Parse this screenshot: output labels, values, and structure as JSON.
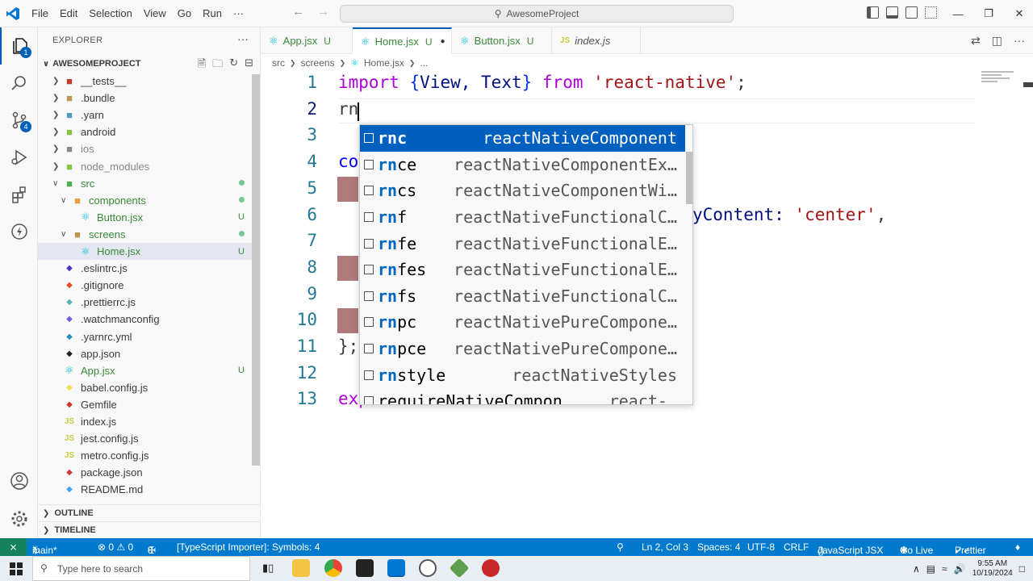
{
  "titlebar": {
    "menus": [
      "File",
      "Edit",
      "Selection",
      "View",
      "Go",
      "Run",
      "···"
    ],
    "search_placeholder": "AwesomeProject"
  },
  "activity": {
    "explorer_badge": "1",
    "scm_badge": "4"
  },
  "sidebar": {
    "title": "EXPLORER",
    "project": "AWESOMEPROJECT",
    "tree": [
      {
        "name": "__tests__",
        "kind": "folder",
        "expanded": false,
        "depth": 0,
        "color": "#c0392b",
        "status": ""
      },
      {
        "name": ".bundle",
        "kind": "folder",
        "expanded": false,
        "depth": 0,
        "color": "#c09553",
        "status": ""
      },
      {
        "name": ".yarn",
        "kind": "folder",
        "expanded": false,
        "depth": 0,
        "color": "#519aba",
        "status": ""
      },
      {
        "name": "android",
        "kind": "folder",
        "expanded": false,
        "depth": 0,
        "color": "#8bc34a",
        "status": ""
      },
      {
        "name": "ios",
        "kind": "folder",
        "expanded": false,
        "depth": 0,
        "color": "#888888",
        "status": ""
      },
      {
        "name": "node_modules",
        "kind": "folder",
        "expanded": false,
        "depth": 0,
        "color": "#8bc34a",
        "status": ""
      },
      {
        "name": "src",
        "kind": "folder",
        "expanded": true,
        "depth": 0,
        "color": "#4caf50",
        "status": "dot"
      },
      {
        "name": "components",
        "kind": "folder",
        "expanded": true,
        "depth": 1,
        "color": "#e6a23c",
        "status": "dot"
      },
      {
        "name": "Button.jsx",
        "kind": "react",
        "depth": 2,
        "color": "#00bcd4",
        "status": "U"
      },
      {
        "name": "screens",
        "kind": "folder",
        "expanded": true,
        "depth": 1,
        "color": "#c09553",
        "status": "dot"
      },
      {
        "name": "Home.jsx",
        "kind": "react",
        "depth": 2,
        "color": "#00bcd4",
        "status": "U",
        "selected": true
      },
      {
        "name": ".eslintrc.js",
        "kind": "file",
        "depth": 0,
        "color": "#4b32c3",
        "status": ""
      },
      {
        "name": ".gitignore",
        "kind": "file",
        "depth": 0,
        "color": "#e44d26",
        "status": ""
      },
      {
        "name": ".prettierrc.js",
        "kind": "file",
        "depth": 0,
        "color": "#56b3b4",
        "status": ""
      },
      {
        "name": ".watchmanconfig",
        "kind": "file",
        "depth": 0,
        "color": "#6b5fe0",
        "status": ""
      },
      {
        "name": ".yarnrc.yml",
        "kind": "file",
        "depth": 0,
        "color": "#2c8ebb",
        "status": ""
      },
      {
        "name": "app.json",
        "kind": "file",
        "depth": 0,
        "color": "#222222",
        "status": ""
      },
      {
        "name": "App.jsx",
        "kind": "react",
        "depth": 0,
        "color": "#00bcd4",
        "status": "U"
      },
      {
        "name": "babel.config.js",
        "kind": "file",
        "depth": 0,
        "color": "#f5da55",
        "status": ""
      },
      {
        "name": "Gemfile",
        "kind": "file",
        "depth": 0,
        "color": "#cc342d",
        "status": ""
      },
      {
        "name": "index.js",
        "kind": "js",
        "depth": 0,
        "color": "#cbcb41",
        "status": ""
      },
      {
        "name": "jest.config.js",
        "kind": "js",
        "depth": 0,
        "color": "#cbcb41",
        "status": ""
      },
      {
        "name": "metro.config.js",
        "kind": "js",
        "depth": 0,
        "color": "#cbcb41",
        "status": ""
      },
      {
        "name": "package.json",
        "kind": "file",
        "depth": 0,
        "color": "#cb3837",
        "status": ""
      },
      {
        "name": "README.md",
        "kind": "file",
        "depth": 0,
        "color": "#42a5f5",
        "status": ""
      }
    ],
    "outline": "OUTLINE",
    "timeline": "TIMELINE"
  },
  "tabs": [
    {
      "label": "App.jsx",
      "status": "U",
      "active": false,
      "italic": false
    },
    {
      "label": "Home.jsx",
      "status": "U",
      "active": true,
      "italic": false,
      "dirty": true
    },
    {
      "label": "Button.jsx",
      "status": "U",
      "active": false,
      "italic": false
    },
    {
      "label": "index.js",
      "status": "",
      "active": false,
      "italic": true,
      "icon": "JS"
    }
  ],
  "breadcrumbs": [
    "src",
    "screens",
    "Home.jsx",
    "..."
  ],
  "editor": {
    "line_numbers": [
      "1",
      "2",
      "3",
      "4",
      "5",
      "6",
      "7",
      "8",
      "9",
      "10",
      "11",
      "12",
      "13"
    ],
    "line1": {
      "kw1": "import",
      "open": "{",
      "ids": "View, Text",
      "close": "}",
      "kw2": "from",
      "str": "'react-native'",
      "end": ";"
    },
    "line2": "rn",
    "line4": "co",
    "line6_tail": "yContent: ",
    "line6_str": "'center'",
    "line6_end": ",",
    "line10": "};",
    "line12": "exp"
  },
  "suggestions": [
    {
      "label": "rnc",
      "detail": "reactNativeComponent",
      "active": true
    },
    {
      "label": "rnce",
      "detail": "reactNativeComponentEx…"
    },
    {
      "label": "rncs",
      "detail": "reactNativeComponentWi…"
    },
    {
      "label": "rnf",
      "detail": "reactNativeFunctionalC…"
    },
    {
      "label": "rnfe",
      "detail": "reactNativeFunctionalE…"
    },
    {
      "label": "rnfes",
      "detail": "reactNativeFunctionalE…"
    },
    {
      "label": "rnfs",
      "detail": "reactNativeFunctionalC…"
    },
    {
      "label": "rnpc",
      "detail": "reactNativePureCompone…"
    },
    {
      "label": "rnpce",
      "detail": "reactNativePureCompone…"
    },
    {
      "label": "rnstyle",
      "detail": "reactNativeStyles"
    },
    {
      "label": "requireNativeCompon",
      "detail": "react-…",
      "partial": true
    }
  ],
  "statusbar": {
    "branch": "main*",
    "problems": "⊗ 0 ⚠ 0",
    "ports": "0",
    "importer": "[TypeScript Importer]: Symbols: 4",
    "position": "Ln 2, Col 3",
    "spaces": "Spaces: 4",
    "encoding": "UTF-8",
    "eol": "CRLF",
    "language": "JavaScript JSX",
    "golive": "Go Live",
    "prettier": "Prettier"
  },
  "taskbar": {
    "search_placeholder": "Type here to search",
    "time": "9:55 AM",
    "date": "10/19/2024"
  }
}
